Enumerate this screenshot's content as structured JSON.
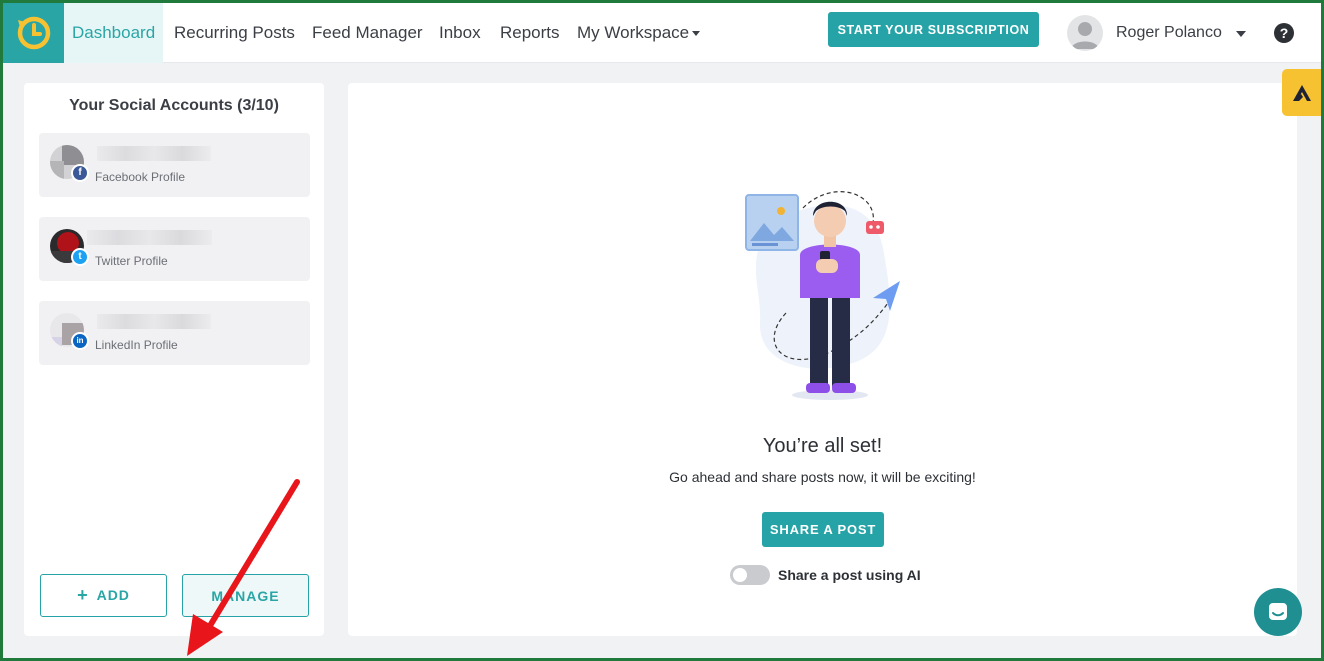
{
  "nav": {
    "items": [
      "Dashboard",
      "Recurring Posts",
      "Feed Manager",
      "Inbox",
      "Reports",
      "My Workspace"
    ],
    "subscribe_label": "START YOUR SUBSCRIPTION",
    "user_name": "Roger Polanco",
    "help_glyph": "?"
  },
  "accounts_panel": {
    "title": "Your Social Accounts (3/10)",
    "accounts": [
      {
        "label": "Facebook Profile",
        "badge": "f",
        "badge_color": "#3b5998"
      },
      {
        "label": "Twitter Profile",
        "badge": "t",
        "badge_color": "#1da1f2"
      },
      {
        "label": "LinkedIn Profile",
        "badge": "in",
        "badge_color": "#0a66c2"
      }
    ],
    "add_label": "ADD",
    "manage_label": "MANAGE"
  },
  "main": {
    "heading": "You’re all set!",
    "subtext": "Go ahead and share posts now, it will be exciting!",
    "share_label": "SHARE A POST",
    "ai_toggle_label": "Share a post using AI",
    "ai_toggle_on": false
  },
  "colors": {
    "brand": "#25a3a6",
    "frame": "#1f7a3c",
    "annotation_arrow": "#e8161b"
  }
}
